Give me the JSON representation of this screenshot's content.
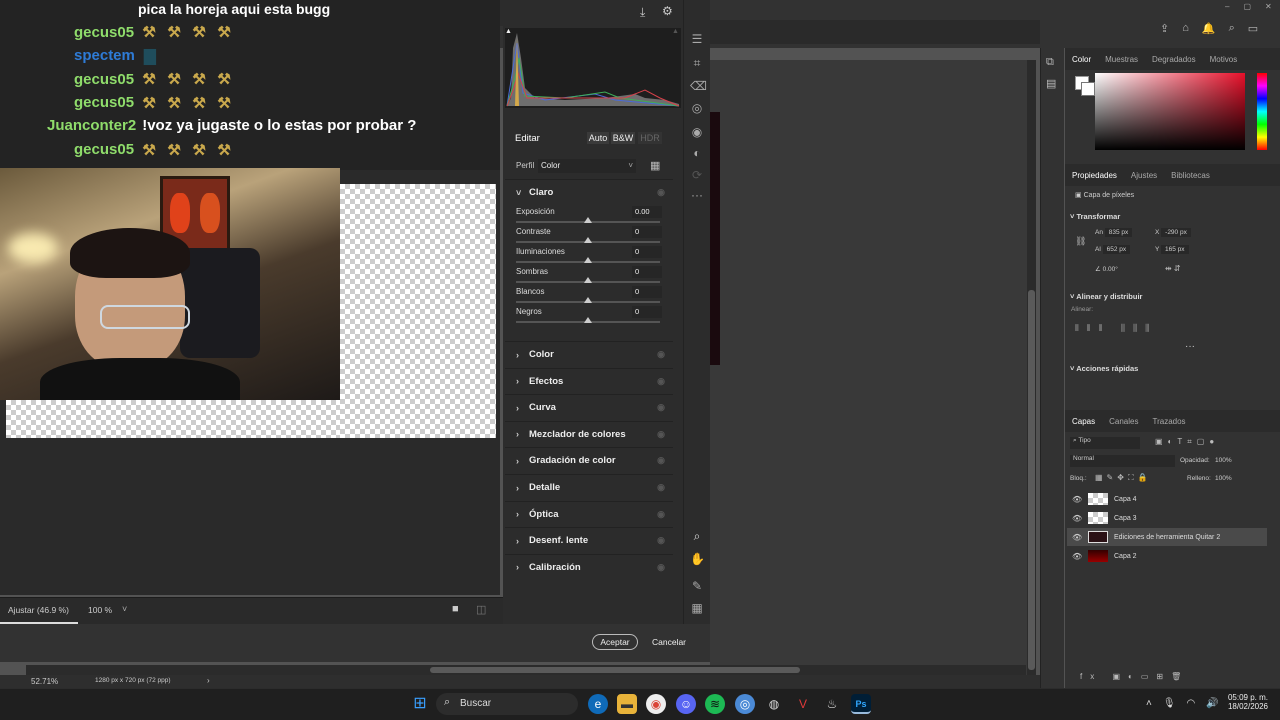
{
  "stream": {
    "title": "pica la horeja aqui esta bugg",
    "chat": [
      {
        "user": "gecus05",
        "color": "#8fdc6b",
        "message": "",
        "emotes": 4
      },
      {
        "user": "spectem",
        "color": "#2e7bd6",
        "message": "",
        "emotes": 1
      },
      {
        "user": "gecus05",
        "color": "#8fdc6b",
        "message": "",
        "emotes": 4
      },
      {
        "user": "gecus05",
        "color": "#8fdc6b",
        "message": "",
        "emotes": 4
      },
      {
        "user": "Juanconter2",
        "color": "#8fdc6b",
        "message": "!voz ya jugaste o lo estas por probar ?",
        "emotes": 0
      },
      {
        "user": "gecus05",
        "color": "#8fdc6b",
        "message": "",
        "emotes": 4
      }
    ]
  },
  "camera_raw": {
    "edit_title": "Editar",
    "auto_label": "Auto",
    "bw_label": "B&W",
    "hdr_label": "HDR",
    "profile_label": "Perfil",
    "profile_value": "Color",
    "light_section": "Claro",
    "sliders": [
      {
        "label": "Exposición",
        "value": "0.00"
      },
      {
        "label": "Contraste",
        "value": "0"
      },
      {
        "label": "Iluminaciones",
        "value": "0"
      },
      {
        "label": "Sombras",
        "value": "0"
      },
      {
        "label": "Blancos",
        "value": "0"
      },
      {
        "label": "Negros",
        "value": "0"
      }
    ],
    "sections": [
      "Color",
      "Efectos",
      "Curva",
      "Mezclador de colores",
      "Gradación de color",
      "Detalle",
      "Óptica",
      "Desenf. lente",
      "Calibración"
    ],
    "zoom_fit": "Ajustar (46.9 %)",
    "zoom_100": "100 %",
    "accept": "Aceptar",
    "cancel": "Cancelar"
  },
  "photoshop": {
    "status_zoom": "52.71%",
    "status_dims": "1280 px x 720 px (72 ppp)",
    "color_tabs": [
      "Color",
      "Muestras",
      "Degradados",
      "Motivos"
    ],
    "props_tabs": [
      "Propiedades",
      "Ajustes",
      "Bibliotecas"
    ],
    "props_layer_type": "Capa de píxeles",
    "transform_title": "Transformar",
    "transform": {
      "w": "835 px",
      "h": "652 px",
      "x": "-290 px",
      "y": "165 px",
      "angle": "0.00°"
    },
    "align_title": "Alinear y distribuir",
    "align_label": "Alinear:",
    "quick_actions": "Acciones rápidas",
    "layers_tabs": [
      "Capas",
      "Canales",
      "Trazados"
    ],
    "layers_filter": "Tipo",
    "blend_mode": "Normal",
    "opacity_label": "Opacidad:",
    "opacity_value": "100%",
    "lock_label": "Bloq.:",
    "fill_label": "Relleno:",
    "fill_value": "100%",
    "layers": [
      "Capa 4",
      "Capa 3",
      "Ediciones de herramienta Quitar 2",
      "Capa 2"
    ]
  },
  "taskbar": {
    "search": "Buscar",
    "time": "05:09 p. m.",
    "date": "18/02/2026"
  },
  "colors": {
    "chat_green": "#8fdc6b",
    "chat_blue": "#2e7bd6",
    "ps_panel": "#323232"
  }
}
